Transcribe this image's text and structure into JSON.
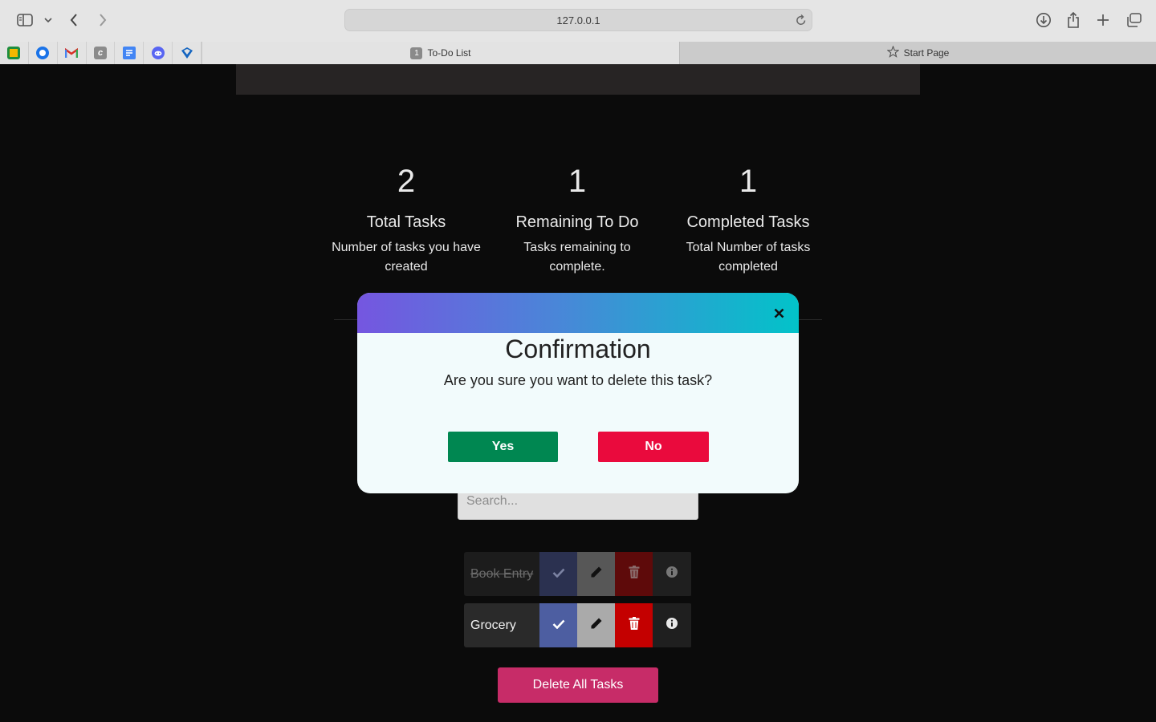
{
  "browser": {
    "url": "127.0.0.1",
    "tabs": [
      {
        "label": "To-Do List",
        "number": "1",
        "active": true
      },
      {
        "label": "Start Page",
        "active": false
      }
    ],
    "favorites": [
      "google-classroom-icon",
      "chrome-icon",
      "gmail-icon",
      "c-icon",
      "google-docs-icon",
      "discord-icon",
      "tool-icon"
    ]
  },
  "stats": [
    {
      "number": "2",
      "title": "Total Tasks",
      "description": "Number of tasks you have created"
    },
    {
      "number": "1",
      "title": "Remaining To Do",
      "description": "Tasks remaining to complete."
    },
    {
      "number": "1",
      "title": "Completed Tasks",
      "description": "Total Number of tasks completed"
    }
  ],
  "search": {
    "placeholder": "Search..."
  },
  "tasks": [
    {
      "name": "Book Entry",
      "completed": true
    },
    {
      "name": "Grocery",
      "completed": false
    }
  ],
  "delete_all_label": "Delete All Tasks",
  "modal": {
    "title": "Confirmation",
    "message": "Are you sure you want to delete this task?",
    "yes_label": "Yes",
    "no_label": "No"
  },
  "colors": {
    "yes": "#008751",
    "no": "#ea0a3d",
    "delete_all": "#c72c68",
    "check_button": "#4d5ea1",
    "edit_button": "#aaaaaa",
    "delete_button": "#c40000"
  }
}
